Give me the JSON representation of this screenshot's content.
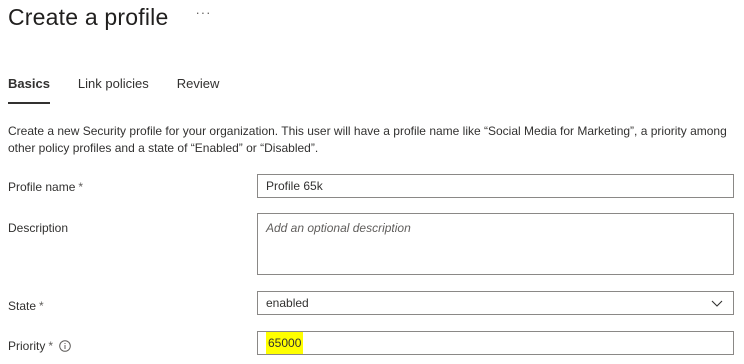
{
  "header": {
    "title": "Create a profile",
    "more_label": "···"
  },
  "tabs": [
    {
      "label": "Basics",
      "active": true
    },
    {
      "label": "Link policies",
      "active": false
    },
    {
      "label": "Review",
      "active": false
    }
  ],
  "intro_text": "Create a new Security profile for your organization. This user will have a profile name like “Social Media for Marketing”, a priority among other policy profiles and a state of “Enabled” or “Disabled”.",
  "form": {
    "profile_name": {
      "label": "Profile name",
      "required_mark": "*",
      "value": "Profile 65k"
    },
    "description": {
      "label": "Description",
      "placeholder": "Add an optional description",
      "value": ""
    },
    "state": {
      "label": "State",
      "required_mark": "*",
      "value": "enabled"
    },
    "priority": {
      "label": "Priority",
      "required_mark": "*",
      "value": "65000",
      "highlight_color": "#ffff00"
    }
  },
  "colors": {
    "text": "#323130",
    "border": "#8a8886",
    "highlight": "#ffff00"
  },
  "icons": {
    "more": "ellipsis-icon",
    "state_dropdown": "chevron-down-icon",
    "priority_info": "info-icon"
  }
}
